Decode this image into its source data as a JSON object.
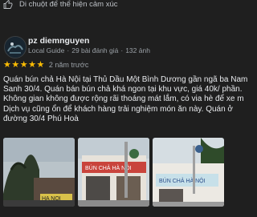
{
  "hint": {
    "text": "Di chuột để thể hiện cảm xúc",
    "icon": "thumbs-up-icon"
  },
  "reviewer": {
    "name": "pz diemnguyen",
    "badge": "Local Guide",
    "reviews": "29 bài đánh giá",
    "photos": "132 ảnh"
  },
  "rating": {
    "stars": 5,
    "max": 5,
    "time": "2 năm trước",
    "star_color": "#fbbc04"
  },
  "review_lines": [
    "Quán bún chả Hà Nội tại Thủ Dầu Một Bình Dương gần ngã ba Nam",
    "Sanh 30/4. Quán bán bún chả khá ngon tại khu vực, giá 40k/ phần.",
    "Không gian không được rộng rãi thoáng mát lắm, có via hè để xe m",
    "Dịch vụ cũng ổn để khách hàng trải nghiệm món ăn này. Quán ở",
    "đường 30/4 Phú Hoà"
  ],
  "photo_signs": [
    "HA NOI",
    "BÚN CHẢ HÀ NỘI",
    "BÚN CHẢ HÀ NỘI"
  ],
  "colors": {
    "background": "#1f1f1f",
    "text": "#e8eaed",
    "muted": "#9aa0a6"
  }
}
